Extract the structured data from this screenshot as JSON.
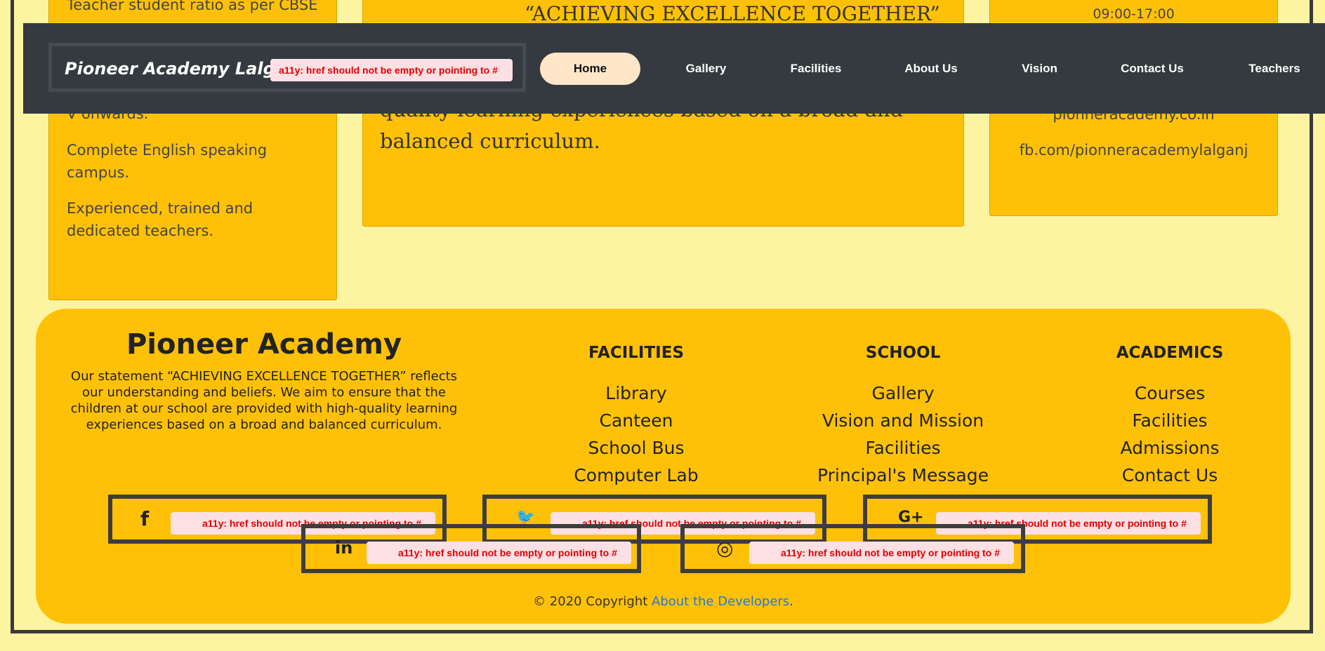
{
  "left_card": {
    "items": [
      "Teacher student ratio as per CBSE",
      "V onwards.",
      "Complete English speaking campus.",
      "Experienced, trained and dedicated teachers."
    ]
  },
  "mid_card": {
    "quote_fragment": "“ACHIEVING EXCELLENCE TOGETHER”",
    "text": "quality learning experiences based on a broad and balanced curriculum."
  },
  "right_card": {
    "hours": "09:00-17:00",
    "website": "pionneracademy.co.in",
    "facebook": "fb.com/pionneracademylalganj"
  },
  "navbar": {
    "brand": "Pioneer Academy Lalganj",
    "a11y_warning": "a11y: href should not be empty or pointing to #",
    "items": [
      "Home",
      "Gallery",
      "Facilities",
      "About Us",
      "Vision",
      "Contact Us",
      "Teachers"
    ]
  },
  "footer": {
    "title": "Pioneer Academy",
    "description": "Our statement “ACHIEVING EXCELLENCE TOGETHER” reflects our understanding and beliefs. We aim to ensure that the children at our school are provided with high-quality learning experiences based on a broad and balanced curriculum.",
    "columns": [
      {
        "heading": "FACILITIES",
        "links": [
          "Library",
          "Canteen",
          "School Bus",
          "Computer Lab"
        ]
      },
      {
        "heading": "SCHOOL",
        "links": [
          "Gallery",
          "Vision and Mission",
          "Facilities",
          "Principal's Message"
        ]
      },
      {
        "heading": "ACADEMICS",
        "links": [
          "Courses",
          "Facilities",
          "Admissions",
          "Contact Us"
        ]
      }
    ],
    "social": [
      {
        "icon": "facebook-icon",
        "glyph": "f"
      },
      {
        "icon": "twitter-icon",
        "glyph": "🐦"
      },
      {
        "icon": "google-plus-icon",
        "glyph": "G+"
      },
      {
        "icon": "linkedin-icon",
        "glyph": "in"
      },
      {
        "icon": "dribbble-icon",
        "glyph": "◎"
      }
    ],
    "a11y_warning": "a11y: href should not be empty or pointing to #",
    "copyright_prefix": "© 2020 Copyright ",
    "copyright_link": "About the Developers",
    "copyright_suffix": "."
  }
}
